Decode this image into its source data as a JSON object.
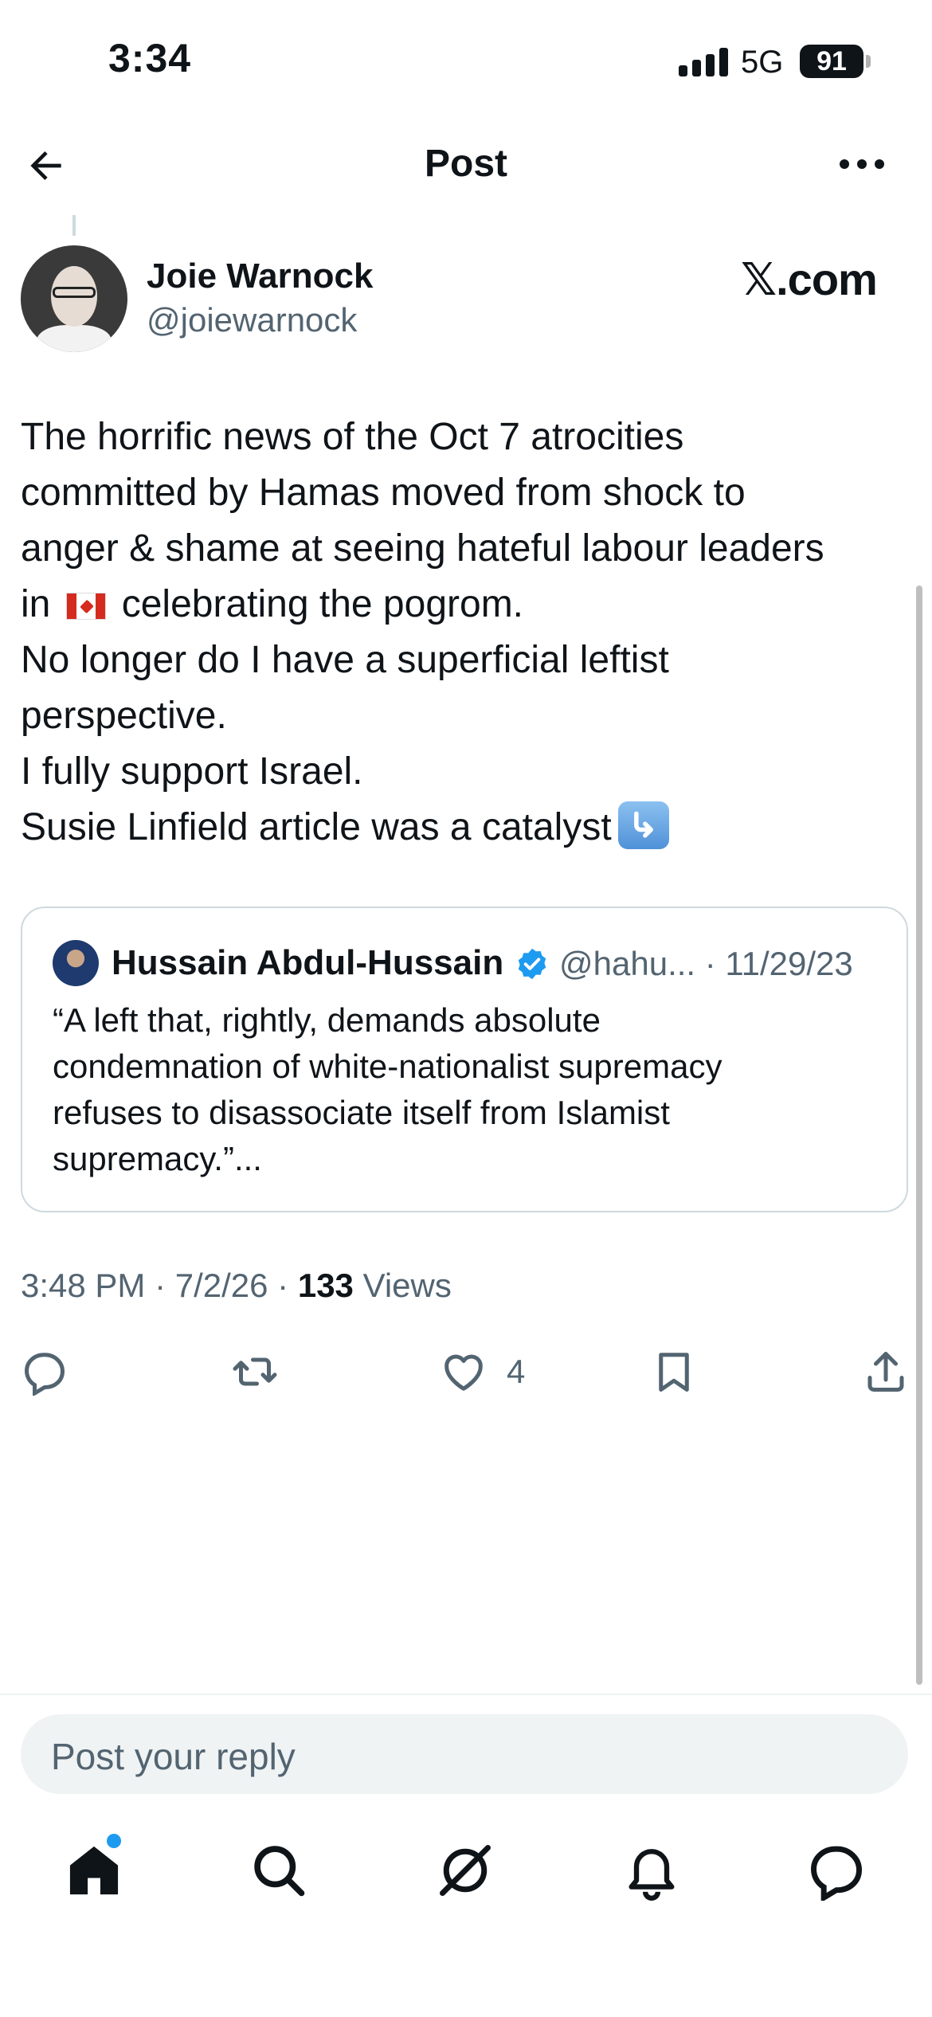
{
  "status_bar": {
    "time": "3:34",
    "network": "5G",
    "battery": "91"
  },
  "header": {
    "title": "Post"
  },
  "post": {
    "author_name": "Joie Warnock",
    "author_handle": "@joiewarnock",
    "badge": "𝕏.com",
    "text_lines": [
      "The horrific news of the Oct 7 atrocities",
      "committed by Hamas moved from shock to",
      "anger & shame at seeing hateful labour leaders",
      "celebrating the pogrom.",
      "No longer do I have a superficial leftist",
      "perspective.",
      "I fully support Israel.",
      "Susie Linfield article was a catalyst"
    ],
    "text_prefix_in": "in",
    "timestamp": "3:48 PM · 7/2/26 · ",
    "views_count": "133",
    "views_label": " Views",
    "like_count": "4"
  },
  "quote": {
    "author_name": "Hussain Abdul-Hussain",
    "author_handle": "@hahu... · 11/29/23",
    "text_lines": [
      "“A left that, rightly, demands absolute",
      "condemnation of white-nationalist supremacy",
      "refuses to disassociate itself from Islamist",
      "supremacy.”..."
    ]
  },
  "reply": {
    "placeholder": "Post your reply"
  },
  "icons": {
    "accent": "#1d9bf0",
    "text": "#0f1419",
    "muted": "#536471"
  }
}
